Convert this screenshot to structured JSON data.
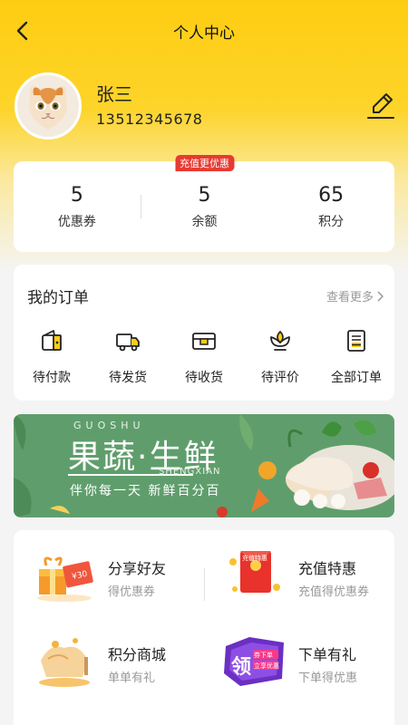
{
  "header": {
    "title": "个人中心"
  },
  "user": {
    "name": "张三",
    "phone": "13512345678"
  },
  "stats": [
    {
      "value": "5",
      "label": "优惠券"
    },
    {
      "value": "5",
      "label": "余额",
      "badge": "充值更优惠"
    },
    {
      "value": "65",
      "label": "积分"
    }
  ],
  "orders": {
    "title": "我的订单",
    "more": "查看更多",
    "items": [
      {
        "label": "待付款",
        "icon": "wallet-icon"
      },
      {
        "label": "待发货",
        "icon": "truck-icon"
      },
      {
        "label": "待收货",
        "icon": "box-icon"
      },
      {
        "label": "待评价",
        "icon": "review-icon"
      },
      {
        "label": "全部订单",
        "icon": "list-icon"
      }
    ]
  },
  "banner": {
    "top_en": "GUOSHU",
    "big": "果蔬·生鲜",
    "mid_en": "SHENGXIAN",
    "slogan": "伴你每一天 新鲜百分百"
  },
  "services": [
    {
      "title": "分享好友",
      "sub": "得优惠券",
      "icon": "gift-box-icon"
    },
    {
      "title": "充值特惠",
      "sub": "充值得优惠券",
      "icon": "red-envelope-icon",
      "image_text": "充值特惠"
    },
    {
      "title": "积分商城",
      "sub": "单单有礼",
      "icon": "points-mall-icon"
    },
    {
      "title": "下单有礼",
      "sub": "下单得优惠",
      "icon": "order-gift-icon",
      "image_text": "领 券下单 立享优惠"
    }
  ],
  "colors": {
    "brand": "#fecd12",
    "badge": "#e73a32",
    "banner_bg": "#5f9e6c"
  }
}
